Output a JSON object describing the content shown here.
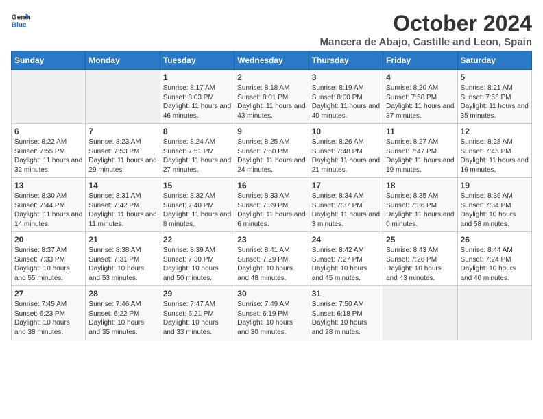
{
  "header": {
    "logo_line1": "General",
    "logo_line2": "Blue",
    "month_title": "October 2024",
    "subtitle": "Mancera de Abajo, Castille and Leon, Spain"
  },
  "weekdays": [
    "Sunday",
    "Monday",
    "Tuesday",
    "Wednesday",
    "Thursday",
    "Friday",
    "Saturday"
  ],
  "weeks": [
    [
      {
        "day": "",
        "sunrise": "",
        "sunset": "",
        "daylight": ""
      },
      {
        "day": "",
        "sunrise": "",
        "sunset": "",
        "daylight": ""
      },
      {
        "day": "1",
        "sunrise": "Sunrise: 8:17 AM",
        "sunset": "Sunset: 8:03 PM",
        "daylight": "Daylight: 11 hours and 46 minutes."
      },
      {
        "day": "2",
        "sunrise": "Sunrise: 8:18 AM",
        "sunset": "Sunset: 8:01 PM",
        "daylight": "Daylight: 11 hours and 43 minutes."
      },
      {
        "day": "3",
        "sunrise": "Sunrise: 8:19 AM",
        "sunset": "Sunset: 8:00 PM",
        "daylight": "Daylight: 11 hours and 40 minutes."
      },
      {
        "day": "4",
        "sunrise": "Sunrise: 8:20 AM",
        "sunset": "Sunset: 7:58 PM",
        "daylight": "Daylight: 11 hours and 37 minutes."
      },
      {
        "day": "5",
        "sunrise": "Sunrise: 8:21 AM",
        "sunset": "Sunset: 7:56 PM",
        "daylight": "Daylight: 11 hours and 35 minutes."
      }
    ],
    [
      {
        "day": "6",
        "sunrise": "Sunrise: 8:22 AM",
        "sunset": "Sunset: 7:55 PM",
        "daylight": "Daylight: 11 hours and 32 minutes."
      },
      {
        "day": "7",
        "sunrise": "Sunrise: 8:23 AM",
        "sunset": "Sunset: 7:53 PM",
        "daylight": "Daylight: 11 hours and 29 minutes."
      },
      {
        "day": "8",
        "sunrise": "Sunrise: 8:24 AM",
        "sunset": "Sunset: 7:51 PM",
        "daylight": "Daylight: 11 hours and 27 minutes."
      },
      {
        "day": "9",
        "sunrise": "Sunrise: 8:25 AM",
        "sunset": "Sunset: 7:50 PM",
        "daylight": "Daylight: 11 hours and 24 minutes."
      },
      {
        "day": "10",
        "sunrise": "Sunrise: 8:26 AM",
        "sunset": "Sunset: 7:48 PM",
        "daylight": "Daylight: 11 hours and 21 minutes."
      },
      {
        "day": "11",
        "sunrise": "Sunrise: 8:27 AM",
        "sunset": "Sunset: 7:47 PM",
        "daylight": "Daylight: 11 hours and 19 minutes."
      },
      {
        "day": "12",
        "sunrise": "Sunrise: 8:28 AM",
        "sunset": "Sunset: 7:45 PM",
        "daylight": "Daylight: 11 hours and 16 minutes."
      }
    ],
    [
      {
        "day": "13",
        "sunrise": "Sunrise: 8:30 AM",
        "sunset": "Sunset: 7:44 PM",
        "daylight": "Daylight: 11 hours and 14 minutes."
      },
      {
        "day": "14",
        "sunrise": "Sunrise: 8:31 AM",
        "sunset": "Sunset: 7:42 PM",
        "daylight": "Daylight: 11 hours and 11 minutes."
      },
      {
        "day": "15",
        "sunrise": "Sunrise: 8:32 AM",
        "sunset": "Sunset: 7:40 PM",
        "daylight": "Daylight: 11 hours and 8 minutes."
      },
      {
        "day": "16",
        "sunrise": "Sunrise: 8:33 AM",
        "sunset": "Sunset: 7:39 PM",
        "daylight": "Daylight: 11 hours and 6 minutes."
      },
      {
        "day": "17",
        "sunrise": "Sunrise: 8:34 AM",
        "sunset": "Sunset: 7:37 PM",
        "daylight": "Daylight: 11 hours and 3 minutes."
      },
      {
        "day": "18",
        "sunrise": "Sunrise: 8:35 AM",
        "sunset": "Sunset: 7:36 PM",
        "daylight": "Daylight: 11 hours and 0 minutes."
      },
      {
        "day": "19",
        "sunrise": "Sunrise: 8:36 AM",
        "sunset": "Sunset: 7:34 PM",
        "daylight": "Daylight: 10 hours and 58 minutes."
      }
    ],
    [
      {
        "day": "20",
        "sunrise": "Sunrise: 8:37 AM",
        "sunset": "Sunset: 7:33 PM",
        "daylight": "Daylight: 10 hours and 55 minutes."
      },
      {
        "day": "21",
        "sunrise": "Sunrise: 8:38 AM",
        "sunset": "Sunset: 7:31 PM",
        "daylight": "Daylight: 10 hours and 53 minutes."
      },
      {
        "day": "22",
        "sunrise": "Sunrise: 8:39 AM",
        "sunset": "Sunset: 7:30 PM",
        "daylight": "Daylight: 10 hours and 50 minutes."
      },
      {
        "day": "23",
        "sunrise": "Sunrise: 8:41 AM",
        "sunset": "Sunset: 7:29 PM",
        "daylight": "Daylight: 10 hours and 48 minutes."
      },
      {
        "day": "24",
        "sunrise": "Sunrise: 8:42 AM",
        "sunset": "Sunset: 7:27 PM",
        "daylight": "Daylight: 10 hours and 45 minutes."
      },
      {
        "day": "25",
        "sunrise": "Sunrise: 8:43 AM",
        "sunset": "Sunset: 7:26 PM",
        "daylight": "Daylight: 10 hours and 43 minutes."
      },
      {
        "day": "26",
        "sunrise": "Sunrise: 8:44 AM",
        "sunset": "Sunset: 7:24 PM",
        "daylight": "Daylight: 10 hours and 40 minutes."
      }
    ],
    [
      {
        "day": "27",
        "sunrise": "Sunrise: 7:45 AM",
        "sunset": "Sunset: 6:23 PM",
        "daylight": "Daylight: 10 hours and 38 minutes."
      },
      {
        "day": "28",
        "sunrise": "Sunrise: 7:46 AM",
        "sunset": "Sunset: 6:22 PM",
        "daylight": "Daylight: 10 hours and 35 minutes."
      },
      {
        "day": "29",
        "sunrise": "Sunrise: 7:47 AM",
        "sunset": "Sunset: 6:21 PM",
        "daylight": "Daylight: 10 hours and 33 minutes."
      },
      {
        "day": "30",
        "sunrise": "Sunrise: 7:49 AM",
        "sunset": "Sunset: 6:19 PM",
        "daylight": "Daylight: 10 hours and 30 minutes."
      },
      {
        "day": "31",
        "sunrise": "Sunrise: 7:50 AM",
        "sunset": "Sunset: 6:18 PM",
        "daylight": "Daylight: 10 hours and 28 minutes."
      },
      {
        "day": "",
        "sunrise": "",
        "sunset": "",
        "daylight": ""
      },
      {
        "day": "",
        "sunrise": "",
        "sunset": "",
        "daylight": ""
      }
    ]
  ]
}
